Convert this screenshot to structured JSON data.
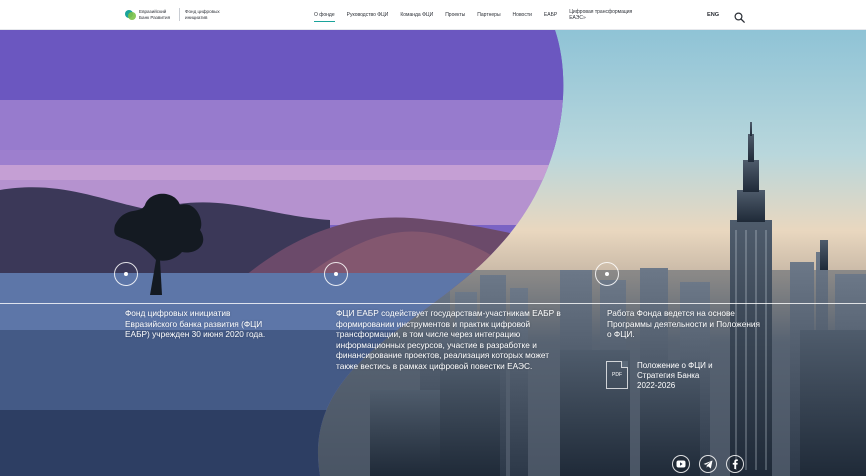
{
  "header": {
    "logo_text": "Евразийский Банк Развития",
    "fund_text": "Фонд цифровых инициатив",
    "nav": [
      {
        "label": "О фонде",
        "active": true
      },
      {
        "label": "Руководство ФЦИ",
        "active": false
      },
      {
        "label": "Команда ФЦИ",
        "active": false
      },
      {
        "label": "Проекты",
        "active": false
      },
      {
        "label": "Партнеры",
        "active": false
      },
      {
        "label": "Новости",
        "active": false
      },
      {
        "label": "ЕАБР",
        "active": false
      },
      {
        "label": "Цифровая трансформация ЕАЭС»",
        "active": false
      }
    ],
    "lang": "ENG",
    "search_icon": "search-icon"
  },
  "timeline": {
    "columns": [
      {
        "text": "Фонд цифровых инициатив Евразийского банка развития (ФЦИ ЕАБР) учрежден 30 июня 2020 года."
      },
      {
        "text": "ФЦИ ЕАБР содействует государствам-участникам ЕАБР в формировании инструментов и практик цифровой трансформации, в том числе через интеграцию информационных ресурсов, участие в разработке и финансирование проектов, реализация которых может также вестись в рамках цифровой повестки ЕАЭС."
      },
      {
        "text": "Работа Фонда ведется на основе Программы деятельности и Положения о ФЦИ."
      }
    ]
  },
  "document": {
    "icon_label": "PDF",
    "text": "Положение о ФЦИ и Стратегия Банка 2022-2026"
  },
  "social": [
    "youtube-icon",
    "telegram-icon",
    "facebook-icon"
  ],
  "colors": {
    "accent": "#1aa39b",
    "logo_green": "#7cc24a",
    "header_bg": "#ffffff"
  }
}
